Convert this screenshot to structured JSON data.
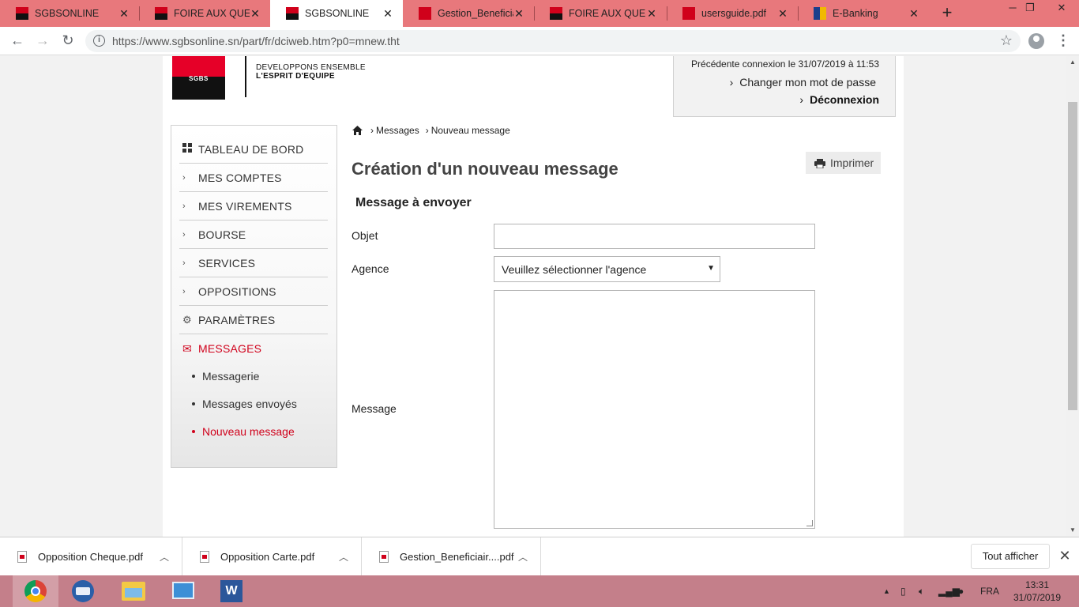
{
  "browser": {
    "tabs": [
      {
        "title": "SGBSONLINE",
        "icon": "sgbs-favicon",
        "active": false
      },
      {
        "title": "FOIRE AUX QUESTI",
        "icon": "sgbs-favicon",
        "active": false
      },
      {
        "title": "SGBSONLINE",
        "icon": "sgbs-favicon",
        "active": true
      },
      {
        "title": "Gestion_Beneficiair",
        "icon": "pdf-favicon",
        "active": false
      },
      {
        "title": "FOIRE AUX QUESTI",
        "icon": "sgbs-favicon",
        "active": false
      },
      {
        "title": "usersguide.pdf",
        "icon": "pdf-favicon",
        "active": false
      },
      {
        "title": "E-Banking",
        "icon": "ebanking-favicon",
        "active": false
      }
    ],
    "url": "https://www.sgbsonline.sn/part/fr/dciweb.htm?p0=mnew.tht"
  },
  "header": {
    "logo_text": "SGBS",
    "slogan_line1": "DEVELOPPONS ENSEMBLE",
    "slogan_line2": "L'ESPRIT D'EQUIPE",
    "previous_login": "Précédente connexion  le 31/07/2019 à 11:53",
    "change_password": "Changer mon mot de passe",
    "logout": "Déconnexion"
  },
  "sidebar": {
    "items": [
      {
        "label": "TABLEAU DE BORD",
        "icon": "dashboard-grid-icon"
      },
      {
        "label": "MES COMPTES",
        "icon": "chevron-right-icon"
      },
      {
        "label": "MES VIREMENTS",
        "icon": "chevron-right-icon"
      },
      {
        "label": "BOURSE",
        "icon": "chevron-right-icon"
      },
      {
        "label": "SERVICES",
        "icon": "chevron-right-icon"
      },
      {
        "label": "OPPOSITIONS",
        "icon": "chevron-right-icon"
      },
      {
        "label": "PARAMÈTRES",
        "icon": "gear-icon"
      },
      {
        "label": "MESSAGES",
        "icon": "envelope-icon",
        "active": true
      }
    ],
    "subitems": [
      {
        "label": "Messagerie"
      },
      {
        "label": "Messages envoyés"
      },
      {
        "label": "Nouveau message",
        "active": true
      }
    ]
  },
  "breadcrumb": [
    "Messages",
    "Nouveau message"
  ],
  "print_label": "Imprimer",
  "main": {
    "title": "Création d'un nouveau message",
    "section_title": "Message à envoyer",
    "form": {
      "object_label": "Objet",
      "object_value": "",
      "agency_label": "Agence",
      "agency_selected": "Veuillez sélectionner l'agence",
      "message_label": "Message",
      "message_value": ""
    }
  },
  "downloads": {
    "items": [
      "Opposition Cheque.pdf",
      "Opposition Carte.pdf",
      "Gestion_Beneficiair....pdf"
    ],
    "show_all": "Tout afficher"
  },
  "taskbar": {
    "language": "FRA",
    "time": "13:31",
    "date": "31/07/2019"
  },
  "colors": {
    "brand_red": "#e60028",
    "active_red": "#d0011b",
    "tabstrip": "#e8787c",
    "taskbar": "#c47f8a"
  }
}
